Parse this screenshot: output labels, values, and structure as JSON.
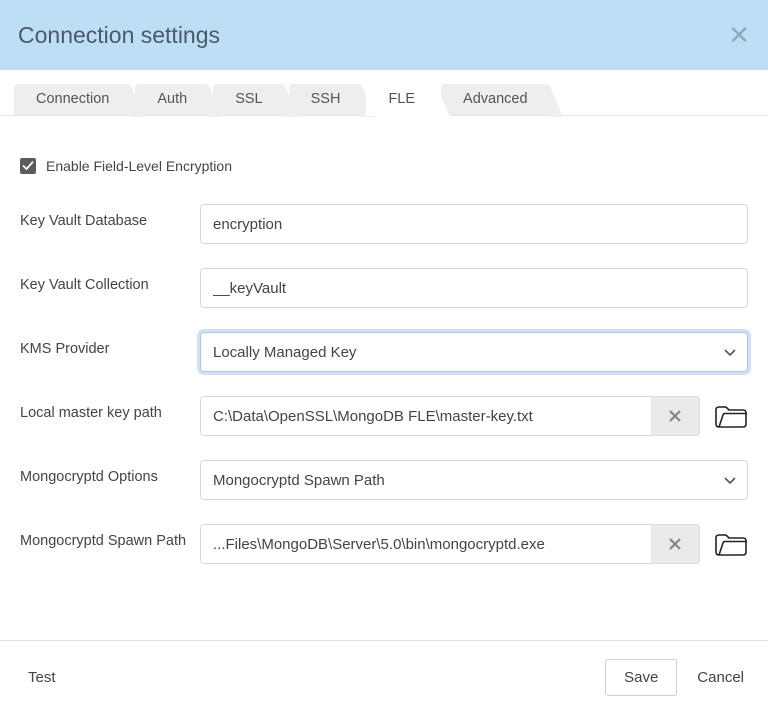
{
  "header": {
    "title": "Connection settings"
  },
  "tabs": {
    "items": [
      "Connection",
      "Auth",
      "SSL",
      "SSH",
      "FLE",
      "Advanced"
    ],
    "active_index": 4
  },
  "enable": {
    "checked": true,
    "label": "Enable Field-Level Encryption"
  },
  "form": {
    "key_vault_db": {
      "label": "Key Vault Database",
      "value": "encryption"
    },
    "key_vault_coll": {
      "label": "Key Vault Collection",
      "value": "__keyVault"
    },
    "kms_provider": {
      "label": "KMS Provider",
      "value": "Locally Managed Key"
    },
    "local_master_key": {
      "label": "Local master key path",
      "value": "C:\\Data\\OpenSSL\\MongoDB FLE\\master-key.txt"
    },
    "mongocryptd_options": {
      "label": "Mongocryptd Options",
      "value": "Mongocryptd Spawn Path"
    },
    "mongocryptd_spawn": {
      "label": "Mongocryptd Spawn Path",
      "value": "...Files\\MongoDB\\Server\\5.0\\bin\\mongocryptd.exe"
    }
  },
  "footer": {
    "test": "Test",
    "save": "Save",
    "cancel": "Cancel"
  }
}
